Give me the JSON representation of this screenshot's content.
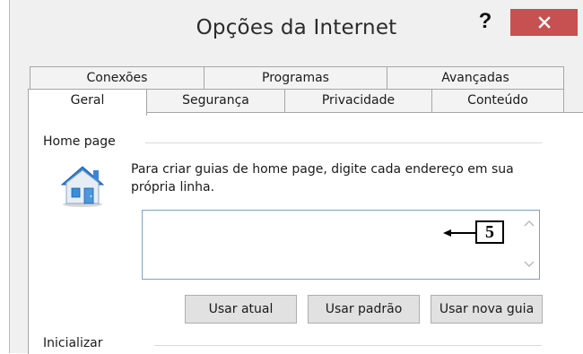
{
  "window": {
    "title": "Opções da Internet"
  },
  "title_bar": {
    "help_label": "?"
  },
  "tabs_top": [
    {
      "label": "Conexões"
    },
    {
      "label": "Programas"
    },
    {
      "label": "Avançadas"
    }
  ],
  "tabs_bottom": [
    {
      "label": "Geral",
      "active": true
    },
    {
      "label": "Segurança"
    },
    {
      "label": "Privacidade"
    },
    {
      "label": "Conteúdo"
    }
  ],
  "home_page": {
    "group_label": "Home page",
    "description": "Para criar guias de home page, digite cada endereço em sua própria linha.",
    "address_value": "",
    "buttons": {
      "use_current": "Usar atual",
      "use_default": "Usar padrão",
      "use_new_tab": "Usar nova guia"
    }
  },
  "callout": {
    "number": "5"
  },
  "startup": {
    "group_label": "Inicializar"
  },
  "colors": {
    "close_button": "#c75050",
    "textarea_border": "#7ba2c8",
    "house_blue": "#2f7fd6"
  },
  "icons": [
    "help-icon",
    "close-icon",
    "home-page-icon",
    "scroll-up-icon",
    "scroll-down-icon",
    "arrow-left-icon"
  ]
}
